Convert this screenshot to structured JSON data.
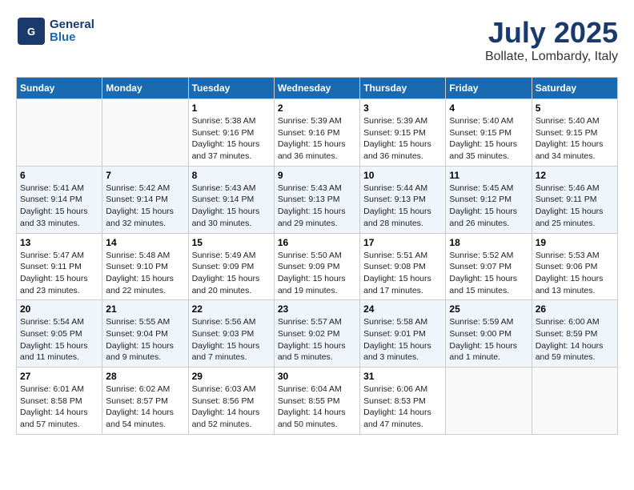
{
  "header": {
    "logo_line1": "General",
    "logo_line2": "Blue",
    "month_year": "July 2025",
    "location": "Bollate, Lombardy, Italy"
  },
  "weekdays": [
    "Sunday",
    "Monday",
    "Tuesday",
    "Wednesday",
    "Thursday",
    "Friday",
    "Saturday"
  ],
  "weeks": [
    [
      {
        "day": "",
        "info": ""
      },
      {
        "day": "",
        "info": ""
      },
      {
        "day": "1",
        "info": "Sunrise: 5:38 AM\nSunset: 9:16 PM\nDaylight: 15 hours\nand 37 minutes."
      },
      {
        "day": "2",
        "info": "Sunrise: 5:39 AM\nSunset: 9:16 PM\nDaylight: 15 hours\nand 36 minutes."
      },
      {
        "day": "3",
        "info": "Sunrise: 5:39 AM\nSunset: 9:15 PM\nDaylight: 15 hours\nand 36 minutes."
      },
      {
        "day": "4",
        "info": "Sunrise: 5:40 AM\nSunset: 9:15 PM\nDaylight: 15 hours\nand 35 minutes."
      },
      {
        "day": "5",
        "info": "Sunrise: 5:40 AM\nSunset: 9:15 PM\nDaylight: 15 hours\nand 34 minutes."
      }
    ],
    [
      {
        "day": "6",
        "info": "Sunrise: 5:41 AM\nSunset: 9:14 PM\nDaylight: 15 hours\nand 33 minutes."
      },
      {
        "day": "7",
        "info": "Sunrise: 5:42 AM\nSunset: 9:14 PM\nDaylight: 15 hours\nand 32 minutes."
      },
      {
        "day": "8",
        "info": "Sunrise: 5:43 AM\nSunset: 9:14 PM\nDaylight: 15 hours\nand 30 minutes."
      },
      {
        "day": "9",
        "info": "Sunrise: 5:43 AM\nSunset: 9:13 PM\nDaylight: 15 hours\nand 29 minutes."
      },
      {
        "day": "10",
        "info": "Sunrise: 5:44 AM\nSunset: 9:13 PM\nDaylight: 15 hours\nand 28 minutes."
      },
      {
        "day": "11",
        "info": "Sunrise: 5:45 AM\nSunset: 9:12 PM\nDaylight: 15 hours\nand 26 minutes."
      },
      {
        "day": "12",
        "info": "Sunrise: 5:46 AM\nSunset: 9:11 PM\nDaylight: 15 hours\nand 25 minutes."
      }
    ],
    [
      {
        "day": "13",
        "info": "Sunrise: 5:47 AM\nSunset: 9:11 PM\nDaylight: 15 hours\nand 23 minutes."
      },
      {
        "day": "14",
        "info": "Sunrise: 5:48 AM\nSunset: 9:10 PM\nDaylight: 15 hours\nand 22 minutes."
      },
      {
        "day": "15",
        "info": "Sunrise: 5:49 AM\nSunset: 9:09 PM\nDaylight: 15 hours\nand 20 minutes."
      },
      {
        "day": "16",
        "info": "Sunrise: 5:50 AM\nSunset: 9:09 PM\nDaylight: 15 hours\nand 19 minutes."
      },
      {
        "day": "17",
        "info": "Sunrise: 5:51 AM\nSunset: 9:08 PM\nDaylight: 15 hours\nand 17 minutes."
      },
      {
        "day": "18",
        "info": "Sunrise: 5:52 AM\nSunset: 9:07 PM\nDaylight: 15 hours\nand 15 minutes."
      },
      {
        "day": "19",
        "info": "Sunrise: 5:53 AM\nSunset: 9:06 PM\nDaylight: 15 hours\nand 13 minutes."
      }
    ],
    [
      {
        "day": "20",
        "info": "Sunrise: 5:54 AM\nSunset: 9:05 PM\nDaylight: 15 hours\nand 11 minutes."
      },
      {
        "day": "21",
        "info": "Sunrise: 5:55 AM\nSunset: 9:04 PM\nDaylight: 15 hours\nand 9 minutes."
      },
      {
        "day": "22",
        "info": "Sunrise: 5:56 AM\nSunset: 9:03 PM\nDaylight: 15 hours\nand 7 minutes."
      },
      {
        "day": "23",
        "info": "Sunrise: 5:57 AM\nSunset: 9:02 PM\nDaylight: 15 hours\nand 5 minutes."
      },
      {
        "day": "24",
        "info": "Sunrise: 5:58 AM\nSunset: 9:01 PM\nDaylight: 15 hours\nand 3 minutes."
      },
      {
        "day": "25",
        "info": "Sunrise: 5:59 AM\nSunset: 9:00 PM\nDaylight: 15 hours\nand 1 minute."
      },
      {
        "day": "26",
        "info": "Sunrise: 6:00 AM\nSunset: 8:59 PM\nDaylight: 14 hours\nand 59 minutes."
      }
    ],
    [
      {
        "day": "27",
        "info": "Sunrise: 6:01 AM\nSunset: 8:58 PM\nDaylight: 14 hours\nand 57 minutes."
      },
      {
        "day": "28",
        "info": "Sunrise: 6:02 AM\nSunset: 8:57 PM\nDaylight: 14 hours\nand 54 minutes."
      },
      {
        "day": "29",
        "info": "Sunrise: 6:03 AM\nSunset: 8:56 PM\nDaylight: 14 hours\nand 52 minutes."
      },
      {
        "day": "30",
        "info": "Sunrise: 6:04 AM\nSunset: 8:55 PM\nDaylight: 14 hours\nand 50 minutes."
      },
      {
        "day": "31",
        "info": "Sunrise: 6:06 AM\nSunset: 8:53 PM\nDaylight: 14 hours\nand 47 minutes."
      },
      {
        "day": "",
        "info": ""
      },
      {
        "day": "",
        "info": ""
      }
    ]
  ]
}
